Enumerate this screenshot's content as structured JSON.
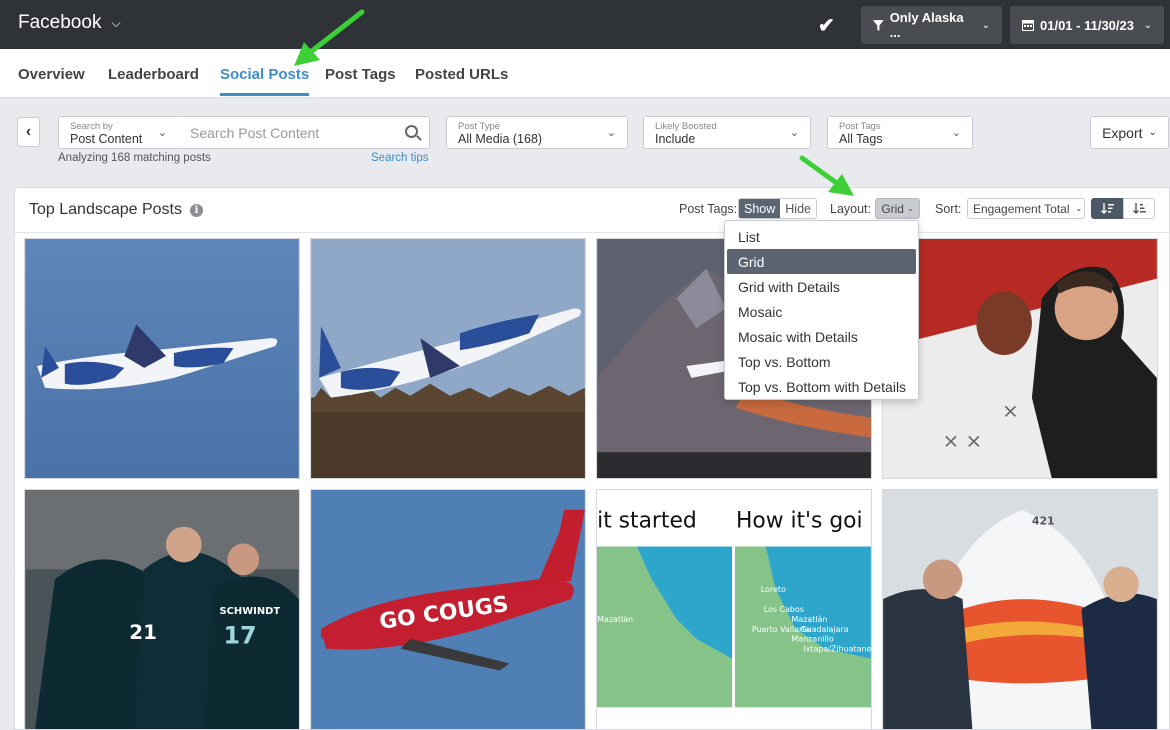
{
  "topbar": {
    "title": "Facebook",
    "filter_label": "Only Alaska ...",
    "date_label": "01/01 - 11/30/23"
  },
  "tabs": [
    {
      "label": "Overview"
    },
    {
      "label": "Leaderboard"
    },
    {
      "label": "Social Posts",
      "active": true
    },
    {
      "label": "Post Tags"
    },
    {
      "label": "Posted URLs"
    }
  ],
  "filters": {
    "search_by_label": "Search by",
    "search_by_value": "Post Content",
    "search_placeholder": "Search Post Content",
    "analyzing": "Analyzing 168 matching posts",
    "search_tips": "Search tips",
    "post_type_label": "Post Type",
    "post_type_value": "All Media (168)",
    "boosted_label": "Likely Boosted",
    "boosted_value": "Include",
    "tags_label": "Post Tags",
    "tags_value": "All Tags",
    "export": "Export"
  },
  "panel": {
    "title": "Top Landscape Posts",
    "post_tags_label": "Post Tags:",
    "show": "Show",
    "hide": "Hide",
    "layout_label": "Layout:",
    "layout_value": "Grid",
    "sort_label": "Sort:",
    "sort_value": "Engagement Total"
  },
  "layout_menu": {
    "selected_index": 1,
    "options": [
      "List",
      "Grid",
      "Grid with Details",
      "Mosaic",
      "Mosaic with Details",
      "Top vs. Bottom",
      "Top vs. Bottom with Details"
    ]
  },
  "tiles": {
    "map_left_heading": "it started",
    "map_right_heading": "How it's goi",
    "map_left_city": "Mazatlán",
    "map_cities": [
      "Loreto",
      "Los Cabos",
      "Mazatlán",
      "Guadalajara",
      "Puerto Vallarta",
      "Manzanillo",
      "Ixtapa/Zihuatanej"
    ],
    "jersey_numbers": [
      "21",
      "17"
    ],
    "jersey_name": "SCHWINDT",
    "plane_text": "GO COUGS",
    "plane_number": "421"
  },
  "colors": {
    "accent": "#3f8ec9",
    "topbar": "#2f3236",
    "arrow": "#3ccf36"
  }
}
